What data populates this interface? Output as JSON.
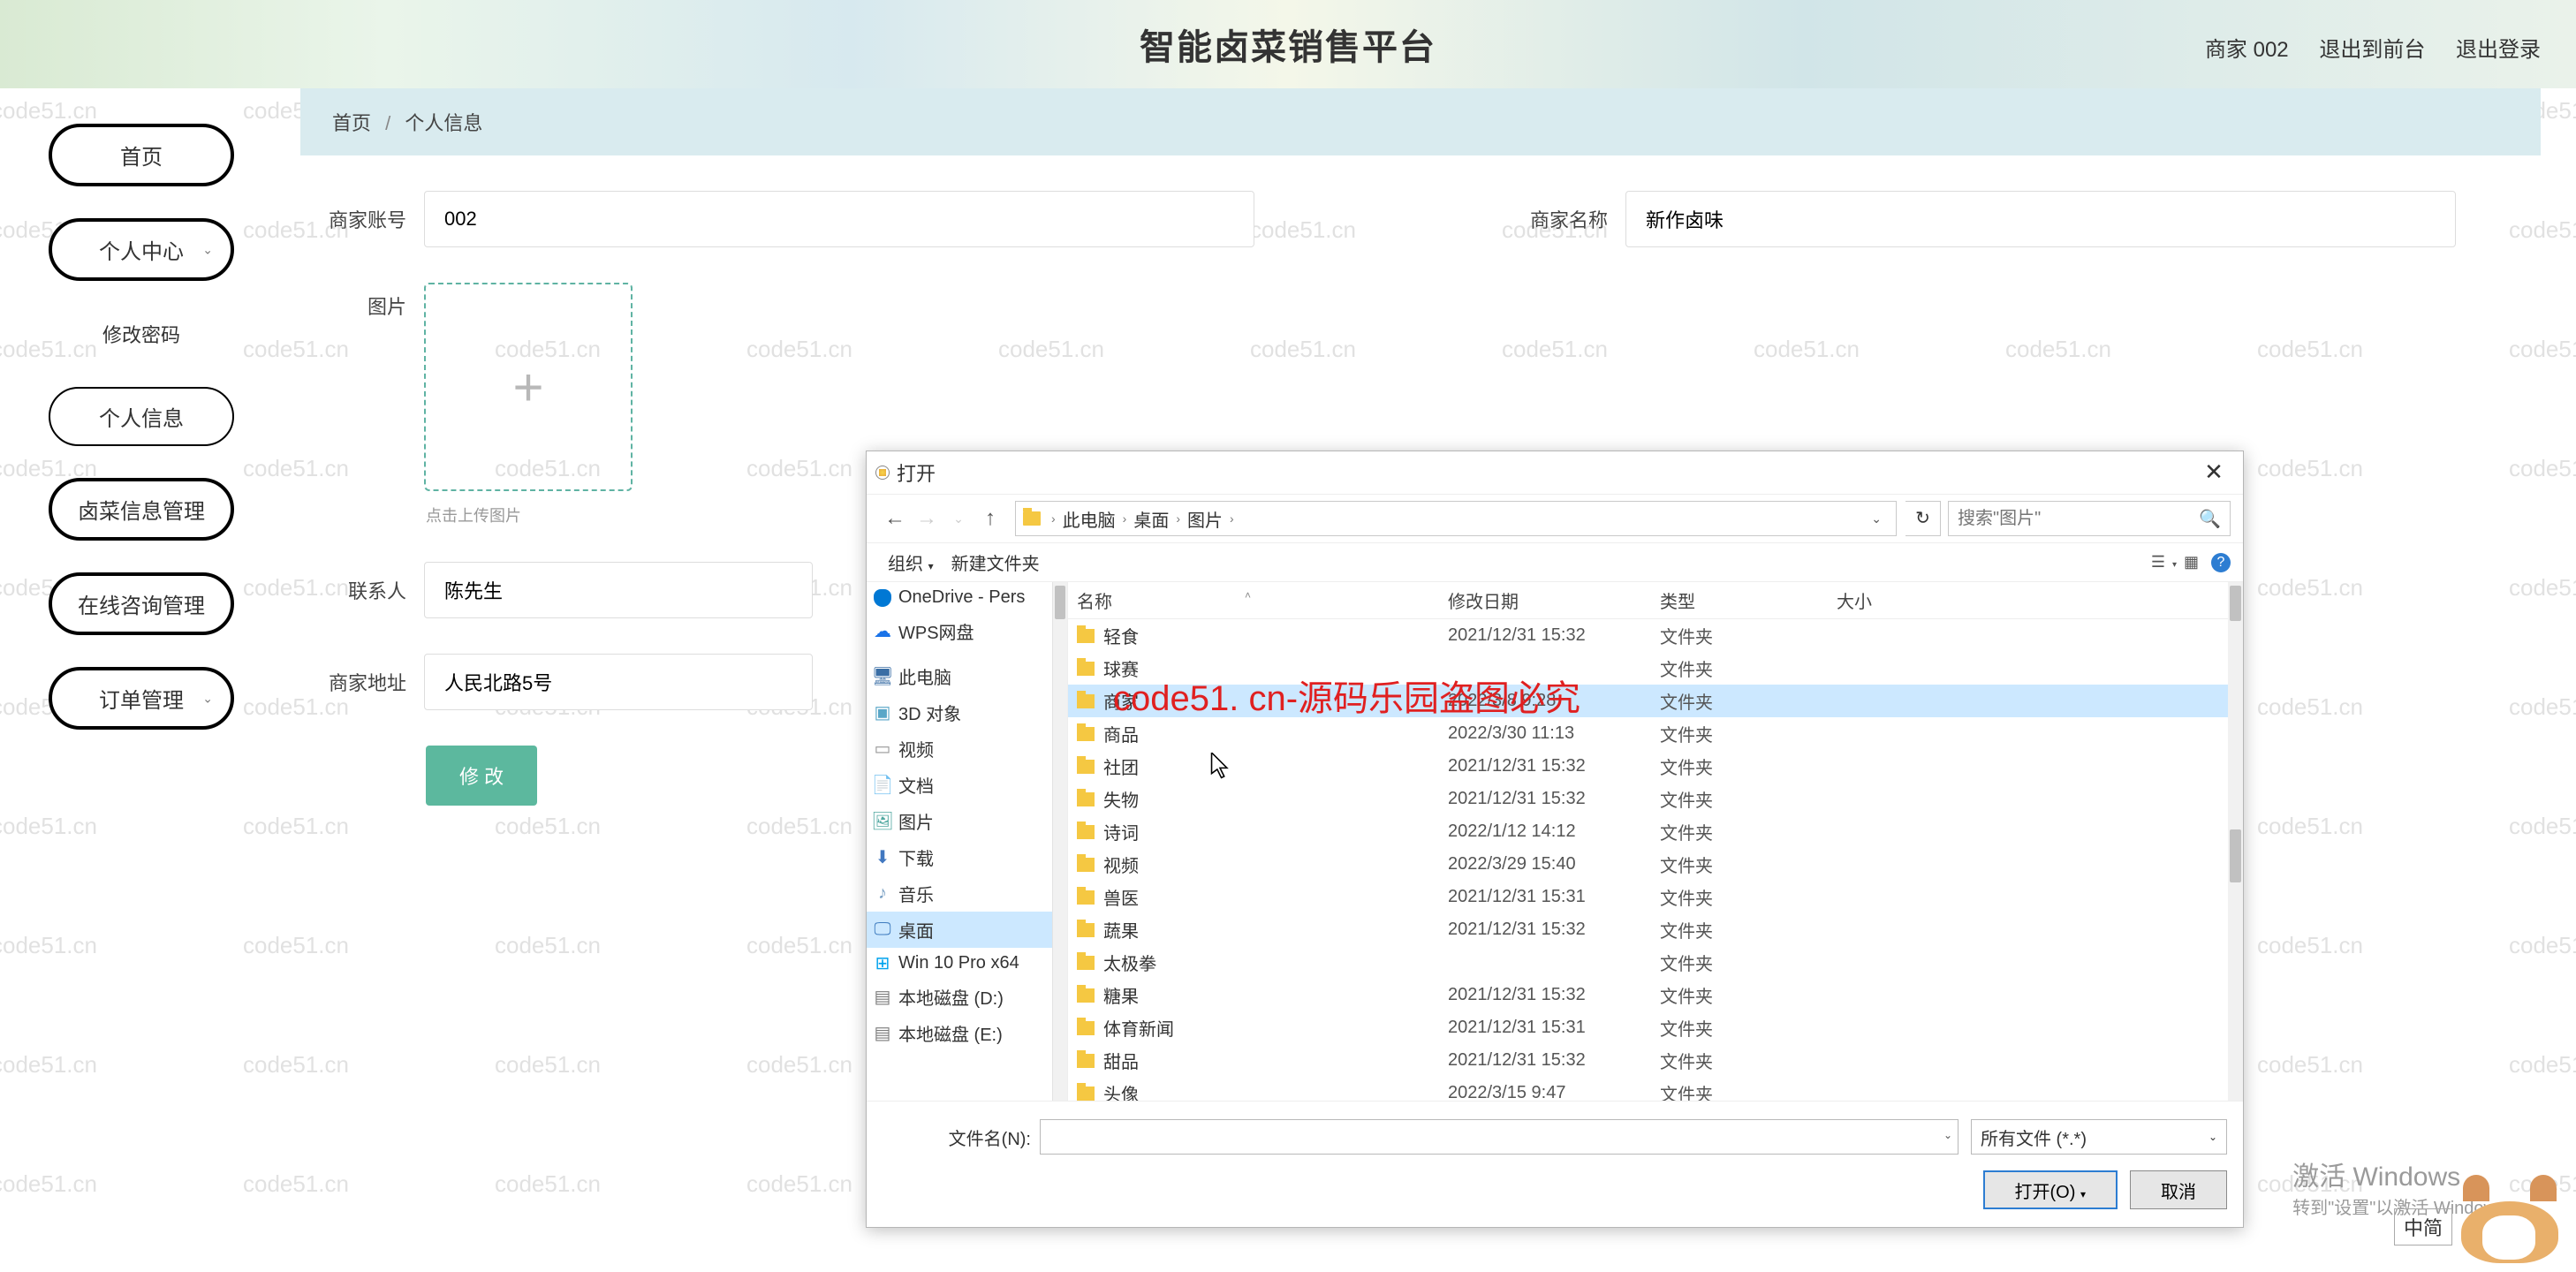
{
  "watermark": "code51.cn",
  "header": {
    "title": "智能卤菜销售平台",
    "user": "商家 002",
    "logout_front": "退出到前台",
    "logout": "退出登录"
  },
  "sidebar": {
    "home": "首页",
    "personal_center": "个人中心",
    "change_pwd": "修改密码",
    "personal_info": "个人信息",
    "dish_mgmt": "卤菜信息管理",
    "consult_mgmt": "在线咨询管理",
    "order_mgmt": "订单管理"
  },
  "breadcrumb": {
    "home": "首页",
    "current": "个人信息"
  },
  "form": {
    "account_label": "商家账号",
    "account_value": "002",
    "name_label": "商家名称",
    "name_value": "新作卤味",
    "pic_label": "图片",
    "upload_hint": "点击上传图片",
    "contact_label": "联系人",
    "contact_value": "陈先生",
    "address_label": "商家地址",
    "address_value": "人民北路5号",
    "submit": "修 改"
  },
  "dialog": {
    "title": "打开",
    "path": {
      "seg1": "此电脑",
      "seg2": "桌面",
      "seg3": "图片"
    },
    "search_placeholder": "搜索\"图片\"",
    "toolbar": {
      "organize": "组织",
      "new_folder": "新建文件夹"
    },
    "tree": {
      "onedrive": "OneDrive - Pers",
      "wps": "WPS网盘",
      "pc": "此电脑",
      "obj3d": "3D 对象",
      "video": "视频",
      "docs": "文档",
      "pics": "图片",
      "downloads": "下载",
      "music": "音乐",
      "desktop": "桌面",
      "win10": "Win 10 Pro x64",
      "driveD": "本地磁盘 (D:)",
      "driveE": "本地磁盘 (E:)"
    },
    "columns": {
      "name": "名称",
      "date": "修改日期",
      "type": "类型",
      "size": "大小"
    },
    "type_folder": "文件夹",
    "rows": [
      {
        "name": "轻食",
        "date": "2021/12/31 15:32"
      },
      {
        "name": "球赛",
        "date": ""
      },
      {
        "name": "商家",
        "date": "2022/3/8 9:28"
      },
      {
        "name": "商品",
        "date": "2022/3/30 11:13"
      },
      {
        "name": "社团",
        "date": "2021/12/31 15:32"
      },
      {
        "name": "失物",
        "date": "2021/12/31 15:32"
      },
      {
        "name": "诗词",
        "date": "2022/1/12 14:12"
      },
      {
        "name": "视频",
        "date": "2022/3/29 15:40"
      },
      {
        "name": "兽医",
        "date": "2021/12/31 15:31"
      },
      {
        "name": "蔬果",
        "date": "2021/12/31 15:32"
      },
      {
        "name": "太极拳",
        "date": ""
      },
      {
        "name": "糖果",
        "date": "2021/12/31 15:32"
      },
      {
        "name": "体育新闻",
        "date": "2021/12/31 15:31"
      },
      {
        "name": "甜品",
        "date": "2021/12/31 15:32"
      },
      {
        "name": "头像",
        "date": "2022/3/15 9:47"
      }
    ],
    "filename_label": "文件名(N):",
    "file_type": "所有文件 (*.*)",
    "open_btn": "打开(O)",
    "cancel_btn": "取消"
  },
  "overlay_red": "code51. cn-源码乐园盗图必究",
  "activate": {
    "l1": "激活 Windows",
    "l2": "转到\"设置\"以激活 Windows"
  },
  "ime": "中简"
}
